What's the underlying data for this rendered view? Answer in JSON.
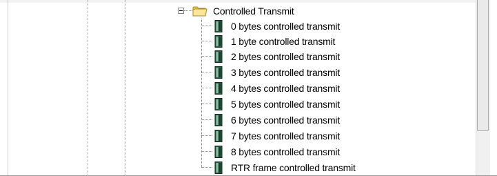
{
  "tree": {
    "root": {
      "label": "Controlled Transmit",
      "icon": "folder-open-icon",
      "expanded": true
    },
    "items": [
      {
        "label": "0 bytes controlled transmit",
        "icon": "can-message-icon"
      },
      {
        "label": "1 byte controlled transmit",
        "icon": "can-message-icon"
      },
      {
        "label": "2 bytes controlled transmit",
        "icon": "can-message-icon"
      },
      {
        "label": "3 bytes controlled transmit",
        "icon": "can-message-icon"
      },
      {
        "label": "4 bytes controlled transmit",
        "icon": "can-message-icon"
      },
      {
        "label": "5 bytes controlled transmit",
        "icon": "can-message-icon"
      },
      {
        "label": "6 bytes controlled transmit",
        "icon": "can-message-icon"
      },
      {
        "label": "7 bytes controlled transmit",
        "icon": "can-message-icon"
      },
      {
        "label": "8 bytes controlled transmit",
        "icon": "can-message-icon"
      },
      {
        "label": "RTR frame controlled transmit",
        "icon": "can-message-icon"
      }
    ]
  },
  "colors": {
    "folder": "#f5d76e",
    "folder_outline": "#b8942c",
    "item_icon_dark": "#1f3b2f",
    "item_icon_light": "#6fa088",
    "text": "#000000"
  }
}
